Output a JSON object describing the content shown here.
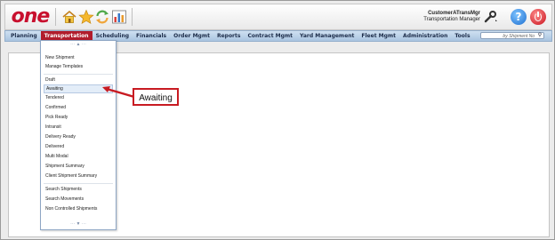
{
  "brand": {
    "logo_text": "one",
    "accent": "#c8102e"
  },
  "header": {
    "user_name": "CustomerATransMgr",
    "user_role": "Transportation Manager",
    "icons": [
      "home-icon",
      "star-icon",
      "refresh-icon",
      "chart-icon",
      "wrench-icon",
      "help-icon",
      "power-icon"
    ]
  },
  "nav": {
    "items": [
      {
        "label": "Planning"
      },
      {
        "label": "Transportation"
      },
      {
        "label": "Scheduling"
      },
      {
        "label": "Financials"
      },
      {
        "label": "Order Mgmt"
      },
      {
        "label": "Reports"
      },
      {
        "label": "Contract Mgmt"
      },
      {
        "label": "Yard Management"
      },
      {
        "label": "Fleet Mgmt"
      },
      {
        "label": "Administration"
      },
      {
        "label": "Tools"
      }
    ],
    "active": "Transportation",
    "search_placeholder": "by Shipment No"
  },
  "dropdown": {
    "items": [
      "New Shipment",
      "Manage Templates",
      "Draft",
      "Awaiting",
      "Tendered",
      "Confirmed",
      "Pick Ready",
      "Intransit",
      "Delivery Ready",
      "Delivered",
      "Multi Modal",
      "Shipment Summary",
      "Client Shipment Summary",
      "Search Shipments",
      "Search Movements",
      "Non Controlled Shipments"
    ],
    "highlighted": "Awaiting"
  },
  "callout": {
    "text": "Awaiting",
    "color": "#c81b22"
  }
}
